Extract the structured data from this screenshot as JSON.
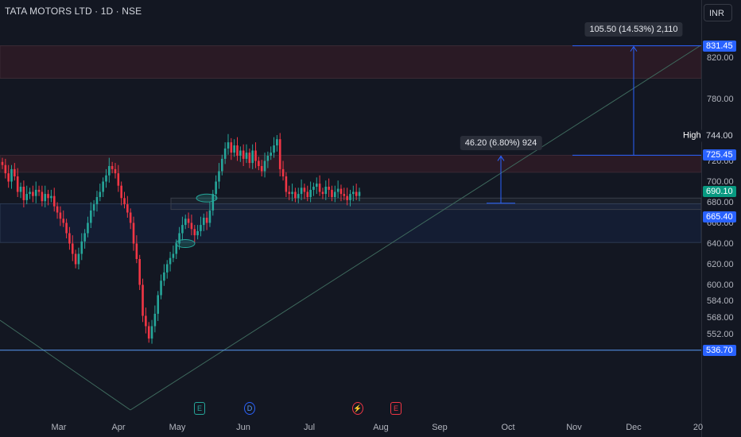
{
  "header": {
    "symbol_line": "TATA MOTORS LTD · 1D · NSE",
    "currency": "INR"
  },
  "colors": {
    "up": "#26a69a",
    "down": "#f23645",
    "blue": "#2962ff",
    "bg": "#131722"
  },
  "y_axis": {
    "ticks": [
      "820.00",
      "780.00",
      "744.00",
      "720.00",
      "700.00",
      "680.00",
      "660.00",
      "640.00",
      "620.00",
      "600.00",
      "584.00",
      "568.00",
      "552.00"
    ]
  },
  "x_axis": {
    "ticks": [
      "Mar",
      "Apr",
      "May",
      "Jun",
      "Jul",
      "Aug",
      "Sep",
      "Oct",
      "Nov",
      "Dec",
      "20"
    ]
  },
  "price_labels": [
    {
      "text": "831.45",
      "kind": "blue"
    },
    {
      "text": "725.45",
      "kind": "blue"
    },
    {
      "text": "690.10",
      "kind": "green"
    },
    {
      "text": "665.40",
      "kind": "blue"
    },
    {
      "text": "536.70",
      "kind": "blue"
    }
  ],
  "high_tag": {
    "label": "High",
    "value": "744.00"
  },
  "measurements": [
    {
      "text": "105.50 (14.53%) 2,110"
    },
    {
      "text": "46.20 (6.80%) 924"
    }
  ],
  "events": [
    {
      "letter": "E",
      "icon": "earnings-icon"
    },
    {
      "letter": "D",
      "icon": "dividend-icon"
    },
    {
      "letter": "⚡",
      "icon": "split-icon"
    },
    {
      "letter": "E",
      "icon": "earnings-icon"
    }
  ],
  "chart_data": {
    "type": "candlestick",
    "title": "TATA MOTORS LTD · 1D · NSE",
    "currency": "INR",
    "ylim": [
      525,
      840
    ],
    "x_months": [
      "Mar",
      "Apr",
      "May",
      "Jun",
      "Jul",
      "Aug",
      "Sep",
      "Oct",
      "Nov",
      "Dec"
    ],
    "closes": [
      716,
      708,
      700,
      712,
      705,
      690,
      695,
      682,
      688,
      690,
      686,
      692,
      690,
      681,
      688,
      684,
      686,
      676,
      670,
      664,
      660,
      650,
      640,
      630,
      620,
      630,
      642,
      650,
      660,
      672,
      678,
      685,
      690,
      700,
      706,
      715,
      712,
      708,
      696,
      684,
      678,
      670,
      660,
      640,
      625,
      600,
      570,
      560,
      548,
      560,
      572,
      590,
      604,
      612,
      620,
      626,
      630,
      640,
      650,
      658,
      664,
      660,
      654,
      648,
      652,
      658,
      665,
      660,
      672,
      688,
      700,
      710,
      722,
      732,
      738,
      728,
      735,
      725,
      730,
      722,
      728,
      718,
      730,
      720,
      715,
      710,
      720,
      725,
      728,
      735,
      741,
      712,
      705,
      690,
      688,
      690,
      684,
      688,
      694,
      690,
      685,
      692,
      695,
      698,
      690,
      688,
      695,
      692,
      685,
      690,
      693,
      688,
      686,
      682,
      688,
      690,
      686,
      690
    ],
    "levels": {
      "r1": 831.45,
      "r2": 725.45,
      "last": 690.1,
      "s1": 665.4,
      "low": 536.7,
      "high": 744.0
    },
    "measure_1": {
      "change": 105.5,
      "percent": 14.53,
      "bars": 2110
    },
    "measure_2": {
      "change": 46.2,
      "percent": 6.8,
      "bars": 924
    },
    "grid": false
  }
}
